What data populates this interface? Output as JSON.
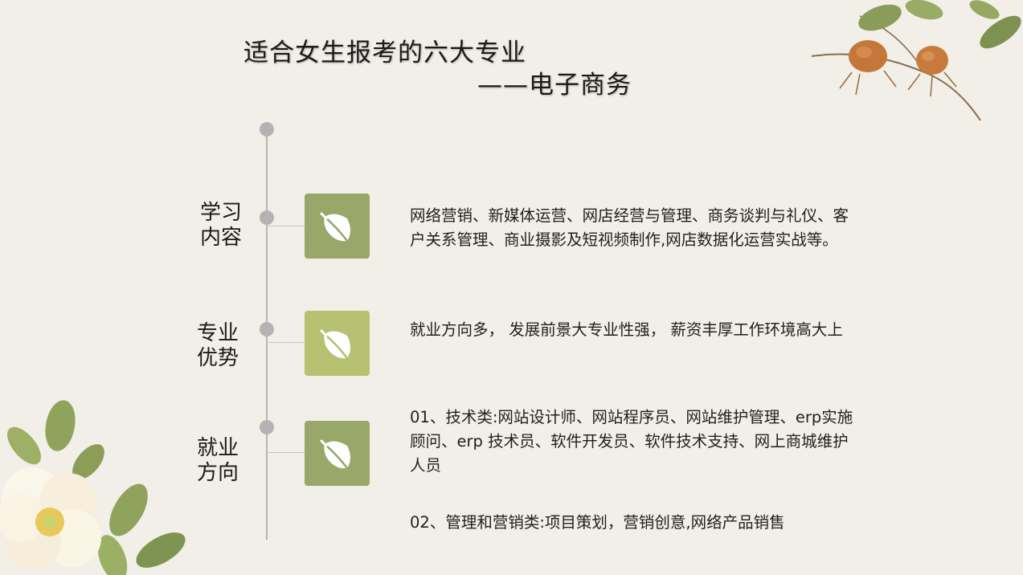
{
  "title": {
    "main": "适合女生报考的六大专业",
    "sub": "——电子商务"
  },
  "sections": [
    {
      "label_line1": "学习",
      "label_line2": "内容",
      "icon": "leaf-icon",
      "icon_color": "#9aa76a",
      "text": "网络营销、新媒体运营、网店经营与管理、商务谈判与礼仪、客户关系管理、商业摄影及短视频制作,网店数据化运营实战等。"
    },
    {
      "label_line1": "专业",
      "label_line2": "优势",
      "icon": "leaf-icon",
      "icon_color": "#b6c172",
      "text": "就业方向多， 发展前景大专业性强， 薪资丰厚工作环境高大上"
    },
    {
      "label_line1": "就业",
      "label_line2": "方向",
      "icon": "leaf-icon",
      "icon_color": "#9aa76a",
      "text": "01、技术类:网站设计师、网站程序员、网站维护管理、erp实施顾问、erp 技术员、软件开发员、软件技术支持、网上商城维护人员",
      "text2": "02、管理和营销类:项目策划，营销创意,网络产品销售"
    }
  ],
  "decor": {
    "top_right": "rosehip-branch-decoration",
    "bottom_left": "white-flower-decoration"
  }
}
